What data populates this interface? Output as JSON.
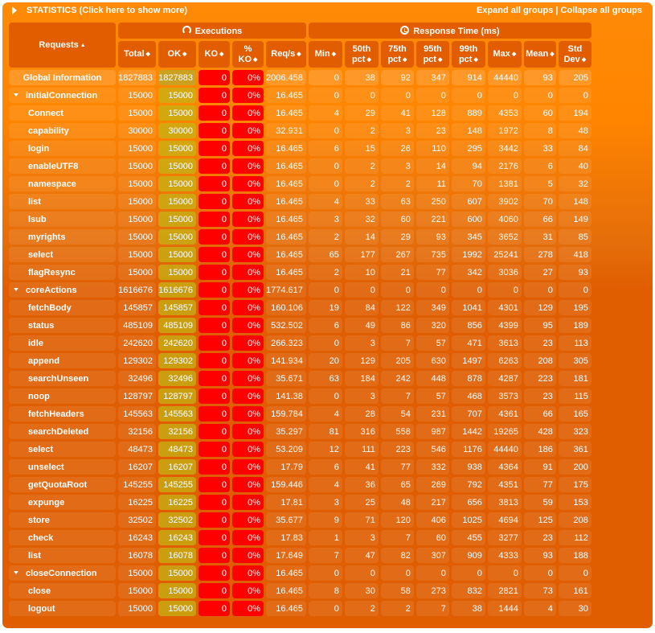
{
  "header": {
    "title": "STATISTICS (Click here to show more)",
    "expand_all": "Expand all groups",
    "separator": " | ",
    "collapse_all": "Collapse all groups"
  },
  "columns": {
    "requests": "Requests",
    "executions_group": "Executions",
    "response_group": "Response Time (ms)",
    "total": "Total",
    "ok": "OK",
    "ko": "KO",
    "pct_ko_1": "%",
    "pct_ko_2": "KO",
    "reqs": "Req/s",
    "min": "Min",
    "p50_1": "50th",
    "p50_2": "pct",
    "p75_1": "75th",
    "p75_2": "pct",
    "p95_1": "95th",
    "p95_2": "pct",
    "p99_1": "99th",
    "p99_2": "pct",
    "max": "Max",
    "mean": "Mean",
    "std_1": "Std",
    "std_2": "Dev"
  },
  "icons": {
    "sort_asc": "▲",
    "sort_both": "◆",
    "executions": "refresh-icon",
    "response": "clock-icon"
  },
  "colors": {
    "panel": "#ff8500",
    "header_cell": "#e25c00",
    "ok_cell": "#c5a011",
    "ko_cell": "#ff0000"
  },
  "rows": [
    {
      "type": "global",
      "name": "Global Information",
      "total": "1827883",
      "ok": "1827883",
      "ko": "0",
      "pct_ko": "0%",
      "rps": "2006.458",
      "min": "0",
      "p50": "38",
      "p75": "92",
      "p95": "347",
      "p99": "914",
      "max": "44440",
      "mean": "93",
      "std": "205"
    },
    {
      "type": "group",
      "name": "initialConnection",
      "total": "15000",
      "ok": "15000",
      "ko": "0",
      "pct_ko": "0%",
      "rps": "16.465",
      "min": "0",
      "p50": "0",
      "p75": "0",
      "p95": "0",
      "p99": "0",
      "max": "0",
      "mean": "0",
      "std": "0"
    },
    {
      "type": "item",
      "name": "Connect",
      "total": "15000",
      "ok": "15000",
      "ko": "0",
      "pct_ko": "0%",
      "rps": "16.465",
      "min": "4",
      "p50": "29",
      "p75": "41",
      "p95": "128",
      "p99": "889",
      "max": "4353",
      "mean": "60",
      "std": "194"
    },
    {
      "type": "item",
      "name": "capability",
      "total": "30000",
      "ok": "30000",
      "ko": "0",
      "pct_ko": "0%",
      "rps": "32.931",
      "min": "0",
      "p50": "2",
      "p75": "3",
      "p95": "23",
      "p99": "148",
      "max": "1972",
      "mean": "8",
      "std": "48"
    },
    {
      "type": "item",
      "name": "login",
      "total": "15000",
      "ok": "15000",
      "ko": "0",
      "pct_ko": "0%",
      "rps": "16.465",
      "min": "6",
      "p50": "15",
      "p75": "26",
      "p95": "110",
      "p99": "295",
      "max": "3442",
      "mean": "33",
      "std": "84"
    },
    {
      "type": "item",
      "name": "enableUTF8",
      "total": "15000",
      "ok": "15000",
      "ko": "0",
      "pct_ko": "0%",
      "rps": "16.465",
      "min": "0",
      "p50": "2",
      "p75": "3",
      "p95": "14",
      "p99": "94",
      "max": "2176",
      "mean": "6",
      "std": "40"
    },
    {
      "type": "item",
      "name": "namespace",
      "total": "15000",
      "ok": "15000",
      "ko": "0",
      "pct_ko": "0%",
      "rps": "16.465",
      "min": "0",
      "p50": "2",
      "p75": "2",
      "p95": "11",
      "p99": "70",
      "max": "1381",
      "mean": "5",
      "std": "32"
    },
    {
      "type": "item",
      "name": "list",
      "total": "15000",
      "ok": "15000",
      "ko": "0",
      "pct_ko": "0%",
      "rps": "16.465",
      "min": "4",
      "p50": "33",
      "p75": "63",
      "p95": "250",
      "p99": "607",
      "max": "3902",
      "mean": "70",
      "std": "148"
    },
    {
      "type": "item",
      "name": "lsub",
      "total": "15000",
      "ok": "15000",
      "ko": "0",
      "pct_ko": "0%",
      "rps": "16.465",
      "min": "3",
      "p50": "32",
      "p75": "60",
      "p95": "221",
      "p99": "600",
      "max": "4060",
      "mean": "66",
      "std": "149"
    },
    {
      "type": "item",
      "name": "myrights",
      "total": "15000",
      "ok": "15000",
      "ko": "0",
      "pct_ko": "0%",
      "rps": "16.465",
      "min": "2",
      "p50": "14",
      "p75": "29",
      "p95": "93",
      "p99": "345",
      "max": "3652",
      "mean": "31",
      "std": "85"
    },
    {
      "type": "item",
      "name": "select",
      "total": "15000",
      "ok": "15000",
      "ko": "0",
      "pct_ko": "0%",
      "rps": "16.465",
      "min": "65",
      "p50": "177",
      "p75": "267",
      "p95": "735",
      "p99": "1992",
      "max": "25241",
      "mean": "278",
      "std": "418"
    },
    {
      "type": "item",
      "name": "flagResync",
      "total": "15000",
      "ok": "15000",
      "ko": "0",
      "pct_ko": "0%",
      "rps": "16.465",
      "min": "2",
      "p50": "10",
      "p75": "21",
      "p95": "77",
      "p99": "342",
      "max": "3036",
      "mean": "27",
      "std": "93"
    },
    {
      "type": "group",
      "name": "coreActions",
      "total": "1616676",
      "ok": "1616676",
      "ko": "0",
      "pct_ko": "0%",
      "rps": "1774.617",
      "min": "0",
      "p50": "0",
      "p75": "0",
      "p95": "0",
      "p99": "0",
      "max": "0",
      "mean": "0",
      "std": "0"
    },
    {
      "type": "item",
      "name": "fetchBody",
      "total": "145857",
      "ok": "145857",
      "ko": "0",
      "pct_ko": "0%",
      "rps": "160.106",
      "min": "19",
      "p50": "84",
      "p75": "122",
      "p95": "349",
      "p99": "1041",
      "max": "4301",
      "mean": "129",
      "std": "195"
    },
    {
      "type": "item",
      "name": "status",
      "total": "485109",
      "ok": "485109",
      "ko": "0",
      "pct_ko": "0%",
      "rps": "532.502",
      "min": "6",
      "p50": "49",
      "p75": "86",
      "p95": "320",
      "p99": "856",
      "max": "4399",
      "mean": "95",
      "std": "189"
    },
    {
      "type": "item",
      "name": "idle",
      "total": "242620",
      "ok": "242620",
      "ko": "0",
      "pct_ko": "0%",
      "rps": "266.323",
      "min": "0",
      "p50": "3",
      "p75": "7",
      "p95": "57",
      "p99": "471",
      "max": "3613",
      "mean": "23",
      "std": "113"
    },
    {
      "type": "item",
      "name": "append",
      "total": "129302",
      "ok": "129302",
      "ko": "0",
      "pct_ko": "0%",
      "rps": "141.934",
      "min": "20",
      "p50": "129",
      "p75": "205",
      "p95": "630",
      "p99": "1497",
      "max": "6263",
      "mean": "208",
      "std": "305"
    },
    {
      "type": "item",
      "name": "searchUnseen",
      "total": "32496",
      "ok": "32496",
      "ko": "0",
      "pct_ko": "0%",
      "rps": "35.671",
      "min": "63",
      "p50": "184",
      "p75": "242",
      "p95": "448",
      "p99": "878",
      "max": "4287",
      "mean": "223",
      "std": "181"
    },
    {
      "type": "item",
      "name": "noop",
      "total": "128797",
      "ok": "128797",
      "ko": "0",
      "pct_ko": "0%",
      "rps": "141.38",
      "min": "0",
      "p50": "3",
      "p75": "7",
      "p95": "57",
      "p99": "468",
      "max": "3573",
      "mean": "23",
      "std": "115"
    },
    {
      "type": "item",
      "name": "fetchHeaders",
      "total": "145563",
      "ok": "145563",
      "ko": "0",
      "pct_ko": "0%",
      "rps": "159.784",
      "min": "4",
      "p50": "28",
      "p75": "54",
      "p95": "231",
      "p99": "707",
      "max": "4361",
      "mean": "66",
      "std": "165"
    },
    {
      "type": "item",
      "name": "searchDeleted",
      "total": "32156",
      "ok": "32156",
      "ko": "0",
      "pct_ko": "0%",
      "rps": "35.297",
      "min": "81",
      "p50": "316",
      "p75": "558",
      "p95": "987",
      "p99": "1442",
      "max": "19265",
      "mean": "428",
      "std": "323"
    },
    {
      "type": "item",
      "name": "select",
      "total": "48473",
      "ok": "48473",
      "ko": "0",
      "pct_ko": "0%",
      "rps": "53.209",
      "min": "12",
      "p50": "111",
      "p75": "223",
      "p95": "546",
      "p99": "1176",
      "max": "44440",
      "mean": "186",
      "std": "361"
    },
    {
      "type": "item",
      "name": "unselect",
      "total": "16207",
      "ok": "16207",
      "ko": "0",
      "pct_ko": "0%",
      "rps": "17.79",
      "min": "6",
      "p50": "41",
      "p75": "77",
      "p95": "332",
      "p99": "938",
      "max": "4364",
      "mean": "91",
      "std": "200"
    },
    {
      "type": "item",
      "name": "getQuotaRoot",
      "total": "145255",
      "ok": "145255",
      "ko": "0",
      "pct_ko": "0%",
      "rps": "159.446",
      "min": "4",
      "p50": "36",
      "p75": "65",
      "p95": "269",
      "p99": "792",
      "max": "4351",
      "mean": "77",
      "std": "175"
    },
    {
      "type": "item",
      "name": "expunge",
      "total": "16225",
      "ok": "16225",
      "ko": "0",
      "pct_ko": "0%",
      "rps": "17.81",
      "min": "3",
      "p50": "25",
      "p75": "48",
      "p95": "217",
      "p99": "656",
      "max": "3813",
      "mean": "59",
      "std": "153"
    },
    {
      "type": "item",
      "name": "store",
      "total": "32502",
      "ok": "32502",
      "ko": "0",
      "pct_ko": "0%",
      "rps": "35.677",
      "min": "9",
      "p50": "71",
      "p75": "120",
      "p95": "406",
      "p99": "1025",
      "max": "4694",
      "mean": "125",
      "std": "208"
    },
    {
      "type": "item",
      "name": "check",
      "total": "16243",
      "ok": "16243",
      "ko": "0",
      "pct_ko": "0%",
      "rps": "17.83",
      "min": "1",
      "p50": "3",
      "p75": "7",
      "p95": "60",
      "p99": "455",
      "max": "3277",
      "mean": "23",
      "std": "112"
    },
    {
      "type": "item",
      "name": "list",
      "total": "16078",
      "ok": "16078",
      "ko": "0",
      "pct_ko": "0%",
      "rps": "17.649",
      "min": "7",
      "p50": "47",
      "p75": "82",
      "p95": "307",
      "p99": "909",
      "max": "4333",
      "mean": "93",
      "std": "188"
    },
    {
      "type": "group",
      "name": "closeConnection",
      "total": "15000",
      "ok": "15000",
      "ko": "0",
      "pct_ko": "0%",
      "rps": "16.465",
      "min": "0",
      "p50": "0",
      "p75": "0",
      "p95": "0",
      "p99": "0",
      "max": "0",
      "mean": "0",
      "std": "0"
    },
    {
      "type": "item",
      "name": "close",
      "total": "15000",
      "ok": "15000",
      "ko": "0",
      "pct_ko": "0%",
      "rps": "16.465",
      "min": "8",
      "p50": "30",
      "p75": "58",
      "p95": "273",
      "p99": "832",
      "max": "2821",
      "mean": "73",
      "std": "161"
    },
    {
      "type": "item",
      "name": "logout",
      "total": "15000",
      "ok": "15000",
      "ko": "0",
      "pct_ko": "0%",
      "rps": "16.465",
      "min": "0",
      "p50": "2",
      "p75": "2",
      "p95": "7",
      "p99": "38",
      "max": "1444",
      "mean": "4",
      "std": "30"
    }
  ]
}
